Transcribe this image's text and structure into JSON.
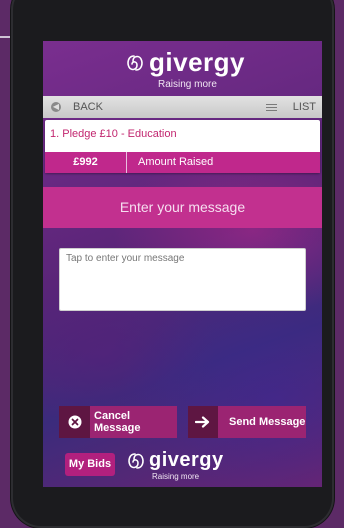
{
  "header": {
    "brand": "givergy",
    "tagline": "Raising more"
  },
  "nav": {
    "back_label": "BACK",
    "list_label": "LIST"
  },
  "lot": {
    "title": "1. Pledge £10 - Education",
    "amount": "£992",
    "amount_label": "Amount Raised"
  },
  "message": {
    "header": "Enter your message",
    "placeholder": "Tap to enter your message"
  },
  "actions": {
    "cancel_label": "Cancel Message",
    "send_label": "Send Message"
  },
  "footer": {
    "my_bids_label": "My Bids",
    "brand": "givergy",
    "tagline": "Raising more"
  },
  "colors": {
    "accent": "#c2308f",
    "button": "#9b2472",
    "button_icon_bg": "#5e1642",
    "lot_title": "#c2266f"
  }
}
